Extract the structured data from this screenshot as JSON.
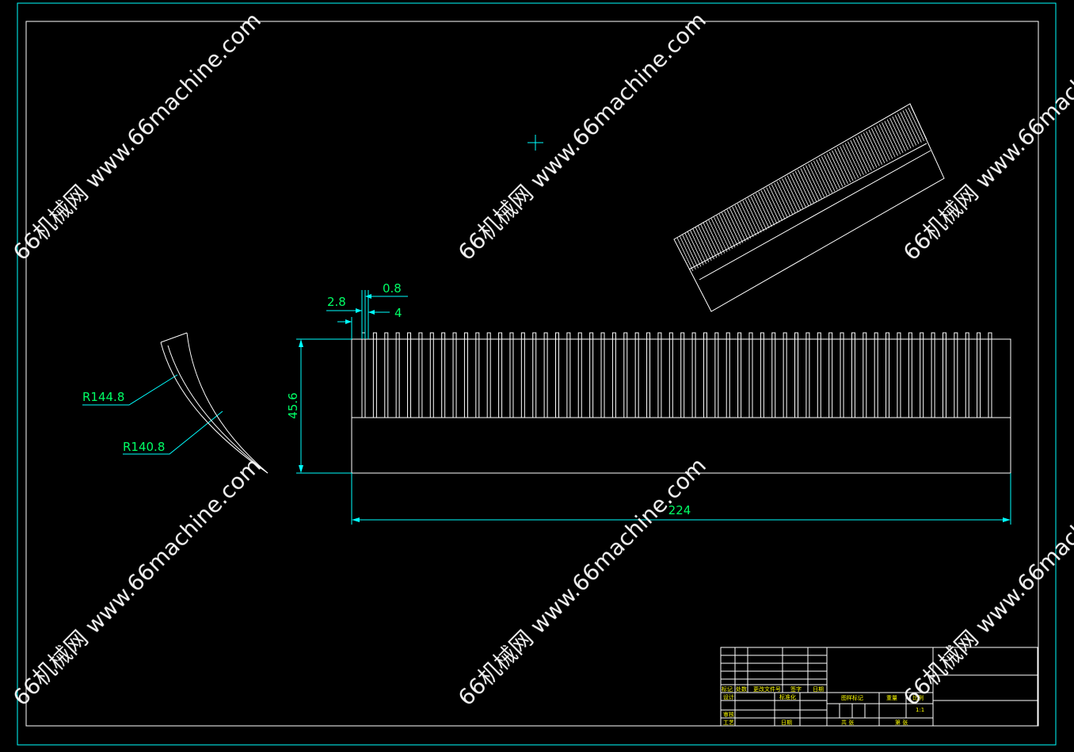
{
  "drawing": {
    "dimensions": {
      "pitch_gap": "2.8",
      "tooth_width": "0.8",
      "pitch": "4",
      "height": "45.6",
      "length": "224",
      "outer_radius": "R144.8",
      "inner_radius": "R140.8"
    },
    "tooth_count": 56
  },
  "title_block": {
    "labels": {
      "mark": "标记",
      "count": "处数",
      "change_doc": "更改文件号",
      "signature": "签字",
      "date": "日期",
      "design": "设计",
      "standardize": "标准化",
      "review": "审核",
      "process": "工艺",
      "date2": "日期",
      "stage_mark": "图样标记",
      "weight": "重量",
      "scale": "比例",
      "scale_value": "1:1",
      "sheets_total": "共 张",
      "sheet_no": "第 张"
    }
  },
  "watermark": {
    "text": "66机械网 www.66machine.com"
  },
  "colors": {
    "background": "#000000",
    "frame": "#00ffff",
    "geometry": "#ffffff",
    "dimension_text": "#00ff66",
    "title_text": "#ffff00"
  }
}
